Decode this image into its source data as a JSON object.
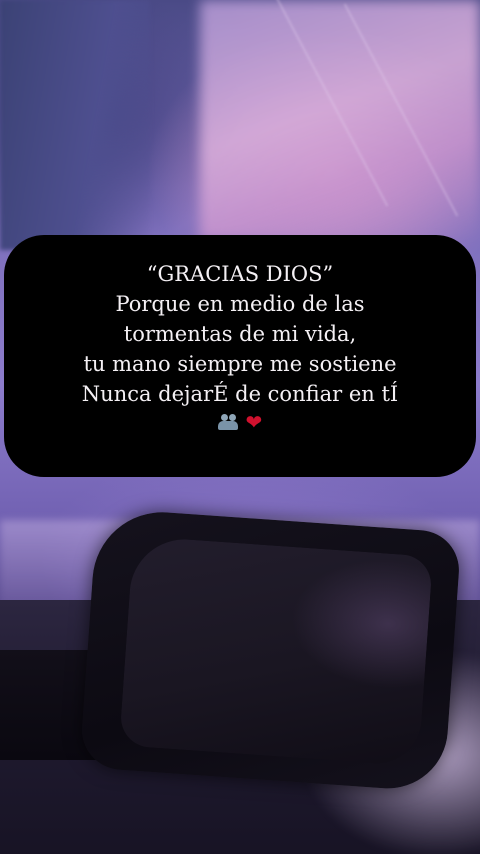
{
  "card": {
    "lines": [
      "“GRACIAS DIOS”",
      "Porque en medio de las",
      "tormentas de mi vida,",
      "tu mano siempre me sostiene",
      "Nunca dejarÉ de confiar en tÍ"
    ],
    "icons": [
      "praying-people-icon",
      "heart-icon"
    ],
    "heart_glyph": "❤",
    "heart_color": "#d0112e"
  },
  "colors": {
    "card_background": "#000000",
    "text": "#f4f0f4",
    "sky_purple": "#8d7ccc"
  }
}
